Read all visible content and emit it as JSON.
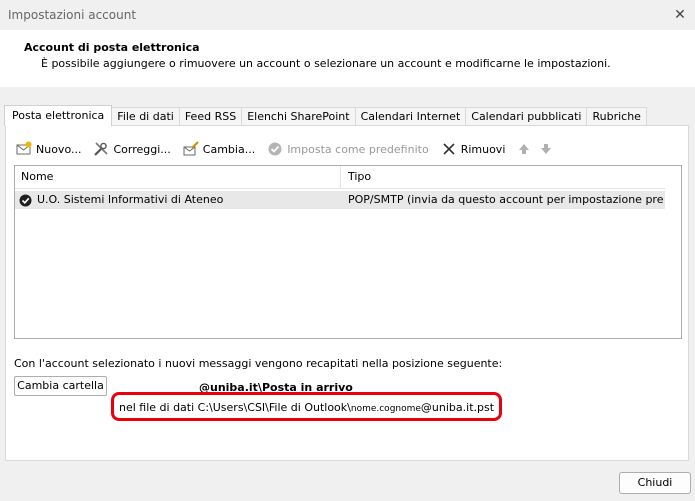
{
  "window": {
    "title": "Impostazioni account"
  },
  "header": {
    "title": "Account di posta elettronica",
    "subtitle": "È possibile aggiungere o rimuovere un account o selezionare un account e modificarne le impostazioni."
  },
  "tabs": [
    {
      "label": "Posta elettronica",
      "active": true
    },
    {
      "label": "File di dati"
    },
    {
      "label": "Feed RSS"
    },
    {
      "label": "Elenchi SharePoint"
    },
    {
      "label": "Calendari Internet"
    },
    {
      "label": "Calendari pubblicati"
    },
    {
      "label": "Rubriche"
    }
  ],
  "toolbar": {
    "new_label": "Nuovo...",
    "repair_label": "Correggi...",
    "change_label": "Cambia...",
    "default_label": "Imposta come predefinito",
    "remove_label": "Rimuovi"
  },
  "list": {
    "columns": {
      "name": "Nome",
      "type": "Tipo"
    },
    "rows": [
      {
        "name": "U.O. Sistemi Informativi di Ateneo",
        "type": "POP/SMTP (invia da questo account per impostazione pred..."
      }
    ]
  },
  "delivery": {
    "description": "Con l'account selezionato i nuovi messaggi vengono recapitati nella posizione seguente:",
    "change_folder_label": "Cambia cartella",
    "folder_path": "@uniba.it\\Posta in arrivo",
    "file_prefix": "nel file di dati C:\\Users\\CSI\\File di Outlook\\",
    "file_user": "nome.cognome",
    "file_suffix": "@uniba.it.pst"
  },
  "footer": {
    "close_label": "Chiudi"
  },
  "colors": {
    "annotation_red": "#e8000b",
    "selected_row": "#e8e8e8"
  }
}
